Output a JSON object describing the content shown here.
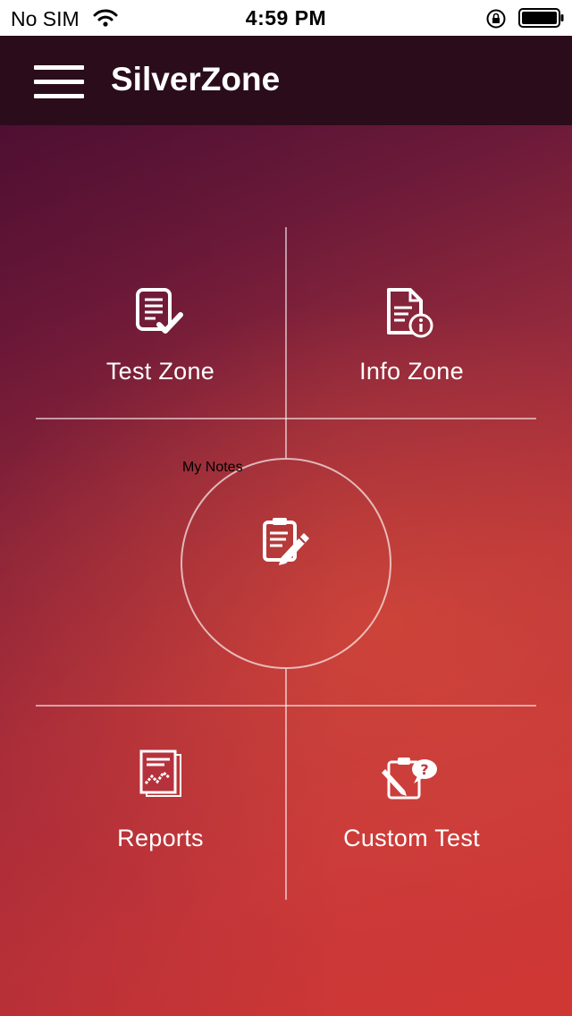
{
  "status_bar": {
    "carrier": "No SIM",
    "time": "4:59 PM",
    "icons": [
      "wifi-icon",
      "orientation-lock-icon",
      "battery-icon"
    ]
  },
  "header": {
    "title": "SilverZone",
    "menu_icon": "hamburger-menu-icon",
    "background": "#2a0c1a"
  },
  "tiles": {
    "test_zone": {
      "label": "Test Zone",
      "icon": "checklist-document-icon"
    },
    "info_zone": {
      "label": "Info Zone",
      "icon": "document-info-icon"
    },
    "my_notes": {
      "label": "My Notes",
      "icon": "clipboard-pencil-icon"
    },
    "reports": {
      "label": "Reports",
      "icon": "report-chart-icon"
    },
    "custom_test": {
      "label": "Custom Test",
      "icon": "clipboard-question-icon"
    }
  },
  "colors": {
    "gradient_top": "#4e1133",
    "gradient_bottom": "#cf3733",
    "text": "#ffffff"
  }
}
